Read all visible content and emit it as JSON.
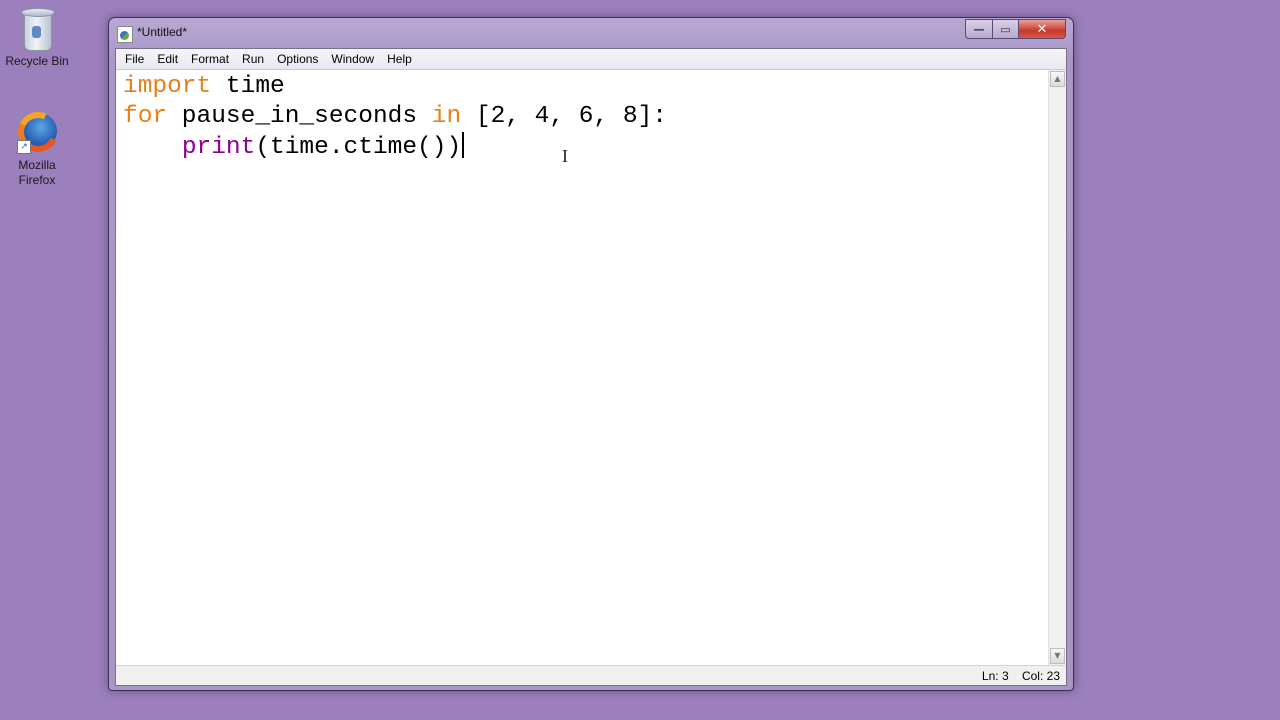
{
  "desktop": {
    "icons": [
      {
        "label": "Recycle Bin",
        "icon": "recycle-bin-icon"
      },
      {
        "label_line1": "Mozilla",
        "label_line2": "Firefox",
        "icon": "firefox-icon"
      }
    ]
  },
  "window": {
    "title": "*Untitled*",
    "controls": {
      "minimize": "—",
      "maximize": "▭",
      "close": "✕"
    }
  },
  "menu": [
    "File",
    "Edit",
    "Format",
    "Run",
    "Options",
    "Window",
    "Help"
  ],
  "editor": {
    "lines": [
      [
        {
          "t": "import",
          "c": "kw"
        },
        {
          "t": " time",
          "c": ""
        }
      ],
      [
        {
          "t": "for",
          "c": "kw"
        },
        {
          "t": " pause_in_seconds ",
          "c": ""
        },
        {
          "t": "in",
          "c": "kw"
        },
        {
          "t": " [2, 4, 6, 8]:",
          "c": ""
        }
      ],
      [
        {
          "t": "    ",
          "c": ""
        },
        {
          "t": "print",
          "c": "bi"
        },
        {
          "t": "(time.ctime())",
          "c": ""
        }
      ]
    ],
    "colors": {
      "keyword": "#e5801b",
      "builtin": "#900090",
      "text": "#000000"
    }
  },
  "scrollbar": {
    "up": "▲",
    "down": "▼"
  },
  "status": {
    "line": "Ln: 3",
    "col": "Col: 23"
  }
}
